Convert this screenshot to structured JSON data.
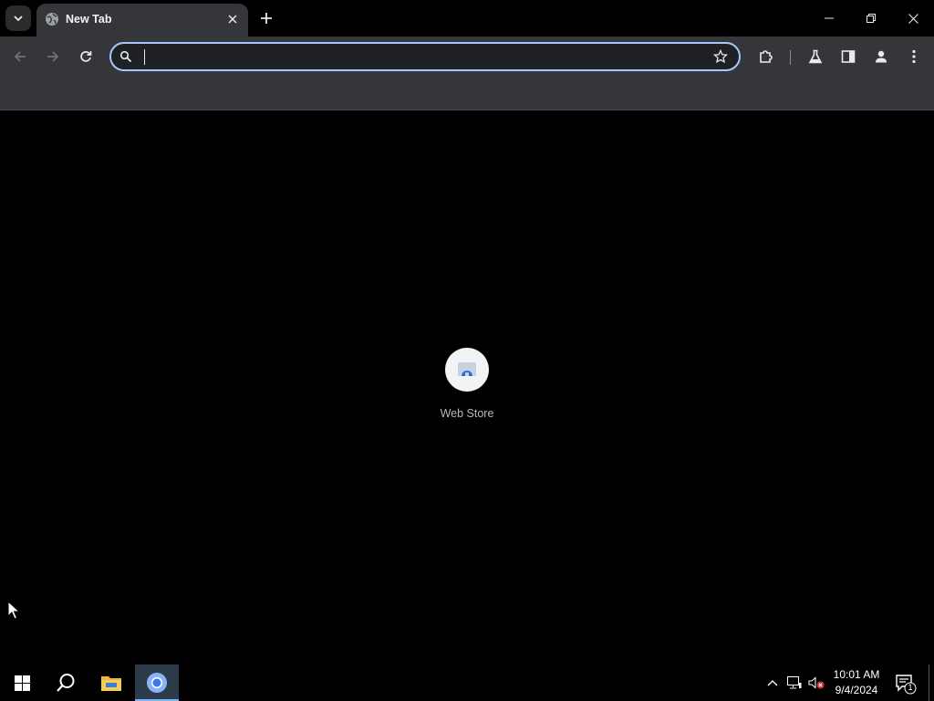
{
  "browser": {
    "tab": {
      "title": "New Tab"
    },
    "omnibox": {
      "value": "",
      "placeholder": ""
    }
  },
  "new_tab_page": {
    "shortcuts": [
      {
        "label": "Web Store",
        "icon": "web-store-icon"
      }
    ]
  },
  "taskbar": {
    "clock": {
      "time": "10:01 AM",
      "date": "9/4/2024"
    },
    "notification_count": "1"
  },
  "colors": {
    "toolbar_bg": "#35363a",
    "omnibox_focus_border": "#a8c7fa",
    "content_bg": "#000000",
    "taskbar_active_underline": "#7ab7f0"
  }
}
